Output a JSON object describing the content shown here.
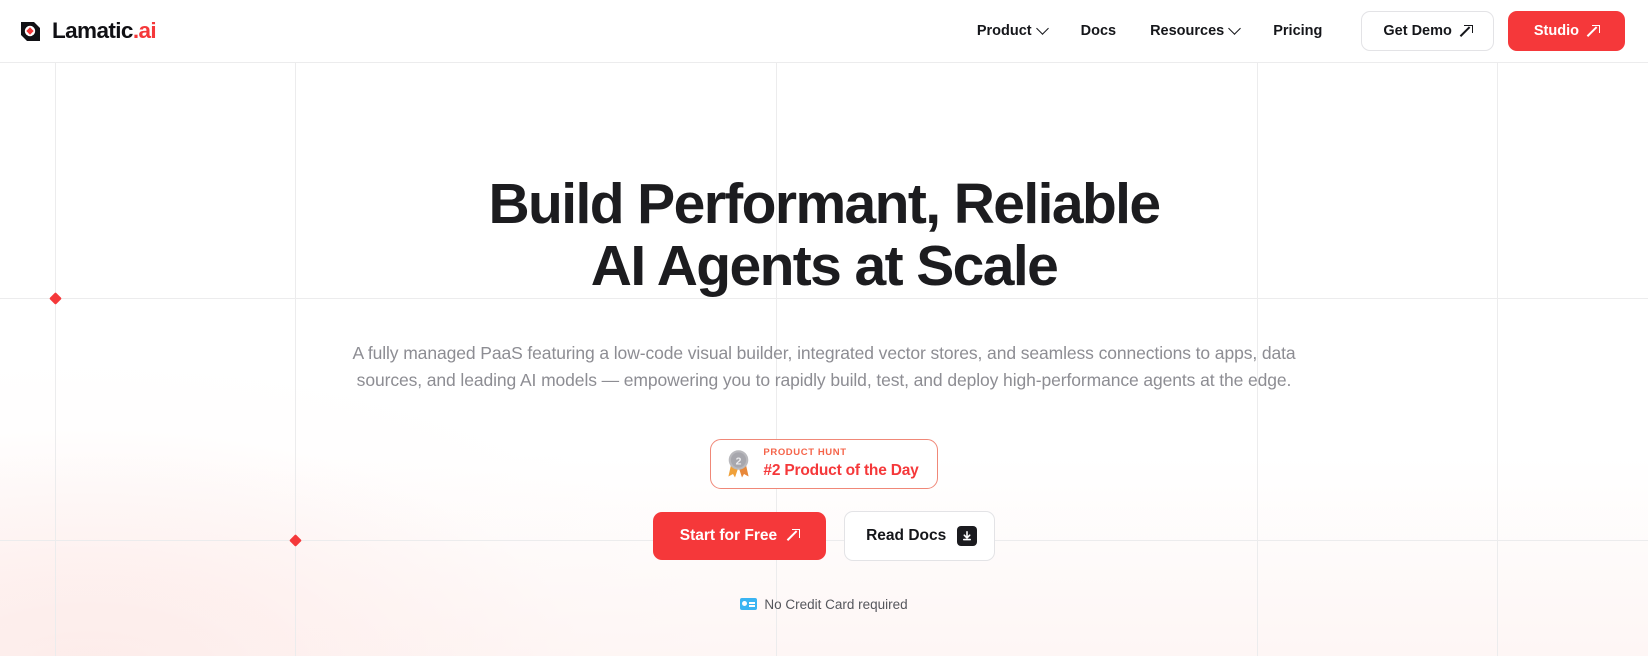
{
  "brand": {
    "name": "Lamatic",
    "suffix": ".ai",
    "logo_icon": "lamatic-diamond-logo",
    "accent_color": "#f5383a"
  },
  "nav": {
    "items": [
      {
        "label": "Product",
        "has_dropdown": true,
        "icon": "chevron-down-icon"
      },
      {
        "label": "Docs",
        "has_dropdown": false,
        "icon": ""
      },
      {
        "label": "Resources",
        "has_dropdown": true,
        "icon": "chevron-down-icon"
      },
      {
        "label": "Pricing",
        "has_dropdown": false,
        "icon": ""
      }
    ],
    "demo_button": {
      "label": "Get Demo",
      "icon": "arrow-up-right-icon"
    },
    "studio_button": {
      "label": "Studio",
      "icon": "arrow-up-right-icon"
    }
  },
  "hero": {
    "title_line1": "Build Performant, Reliable",
    "title_line2": "AI Agents at Scale",
    "subtitle": "A fully managed PaaS featuring a low-code visual builder, integrated vector stores, and seamless connections to apps, data sources, and leading AI models — empowering you to rapidly build, test, and deploy high-performance agents at the edge."
  },
  "product_hunt_badge": {
    "icon": "medal-award-icon",
    "kicker": "PRODUCT HUNT",
    "title": "#2 Product of the Day",
    "border_color": "#f08878",
    "text_color": "#f5383a"
  },
  "cta": {
    "primary": {
      "label": "Start for Free",
      "icon": "arrow-up-right-icon",
      "color": "#f5383a"
    },
    "secondary": {
      "label": "Read Docs",
      "icon": "download-icon"
    }
  },
  "footnote": {
    "icon": "credit-card-icon",
    "text": "No Credit Card required"
  }
}
